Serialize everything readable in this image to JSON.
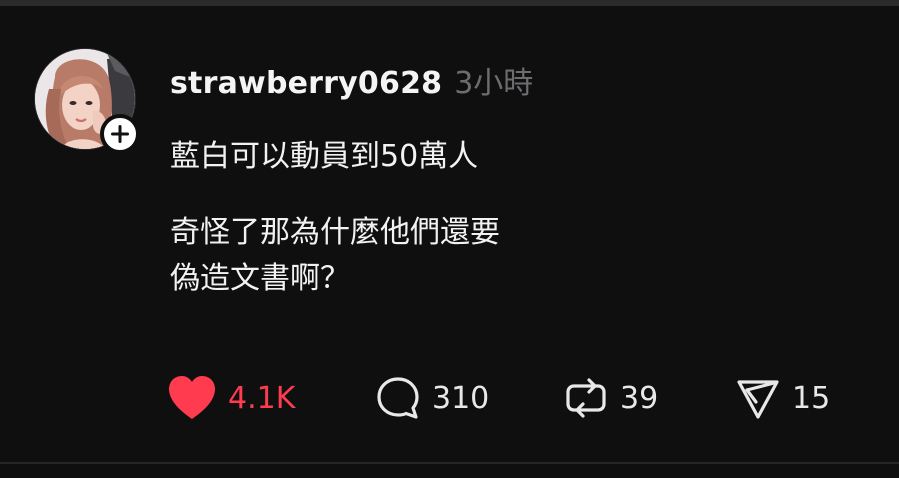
{
  "post": {
    "author": {
      "username": "strawberry0628",
      "avatar_icon": "profile-photo-avatar",
      "follow_icon": "plus-icon"
    },
    "timestamp": "3小時",
    "content": {
      "lines": [
        "藍白可以動員到50萬人",
        "奇怪了那為什麼他們還要",
        "偽造文書啊？"
      ]
    },
    "actions": {
      "like": {
        "icon": "heart-icon",
        "count": "4.1K",
        "liked": true,
        "color": "#ff3b4f"
      },
      "reply": {
        "icon": "speech-bubble-icon",
        "count": "310"
      },
      "repost": {
        "icon": "repost-arrows-icon",
        "count": "39"
      },
      "share": {
        "icon": "paper-plane-icon",
        "count": "15"
      }
    }
  },
  "colors": {
    "background": "#0f0f10",
    "text": "#f2f2f2",
    "muted": "#6d6d70",
    "like_red": "#ff3b4f"
  }
}
